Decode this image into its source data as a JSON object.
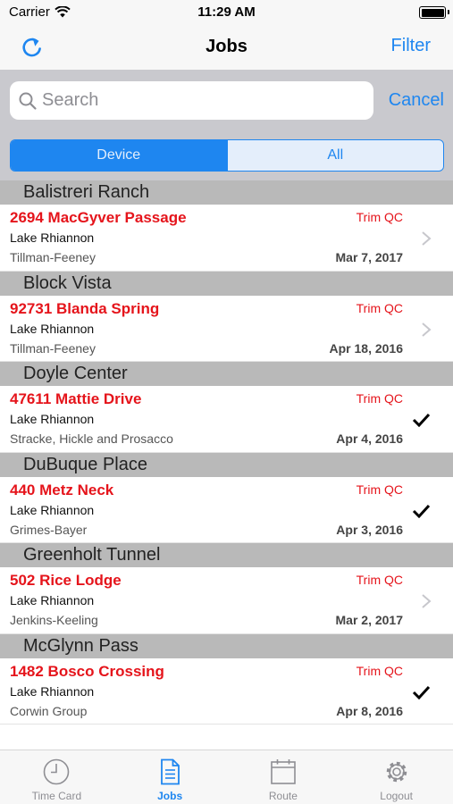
{
  "status_bar": {
    "carrier": "Carrier",
    "time": "11:29 AM"
  },
  "nav": {
    "title": "Jobs",
    "filter_label": "Filter",
    "refresh_icon": "refresh-icon"
  },
  "search": {
    "placeholder": "Search",
    "cancel_label": "Cancel"
  },
  "segment": {
    "options": [
      "Device",
      "All"
    ],
    "selected": "Device"
  },
  "sections": [
    {
      "header": "Balistreri Ranch",
      "address": "2694 MacGyver Passage",
      "type": "Trim QC",
      "city": "Lake Rhiannon",
      "company": "Tillman-Feeney",
      "date": "Mar 7, 2017",
      "accessory": "chevron"
    },
    {
      "header": "Block Vista",
      "address": "92731 Blanda Spring",
      "type": "Trim QC",
      "city": "Lake Rhiannon",
      "company": "Tillman-Feeney",
      "date": "Apr 18, 2016",
      "accessory": "chevron"
    },
    {
      "header": "Doyle Center",
      "address": "47611 Mattie Drive",
      "type": "Trim QC",
      "city": "Lake Rhiannon",
      "company": "Stracke, Hickle and Prosacco",
      "date": "Apr 4, 2016",
      "accessory": "checkmark"
    },
    {
      "header": "DuBuque Place",
      "address": "440 Metz Neck",
      "type": "Trim QC",
      "city": "Lake Rhiannon",
      "company": "Grimes-Bayer",
      "date": "Apr 3, 2016",
      "accessory": "checkmark"
    },
    {
      "header": "Greenholt Tunnel",
      "address": "502 Rice Lodge",
      "type": "Trim QC",
      "city": "Lake Rhiannon",
      "company": "Jenkins-Keeling",
      "date": "Mar 2, 2017",
      "accessory": "chevron"
    },
    {
      "header": "McGlynn Pass",
      "address": "1482 Bosco Crossing",
      "type": "Trim QC",
      "city": "Lake Rhiannon",
      "company": "Corwin Group",
      "date": "Apr 8, 2016",
      "accessory": "checkmark"
    }
  ],
  "tabs": [
    {
      "label": "Time Card",
      "icon": "clock-icon",
      "active": false
    },
    {
      "label": "Jobs",
      "icon": "document-icon",
      "active": true
    },
    {
      "label": "Route",
      "icon": "calendar-icon",
      "active": false
    },
    {
      "label": "Logout",
      "icon": "gear-icon",
      "active": false
    }
  ],
  "colors": {
    "accent": "#1e86f0",
    "address_red": "#e5141b",
    "section_header": "#b9b9b9"
  }
}
